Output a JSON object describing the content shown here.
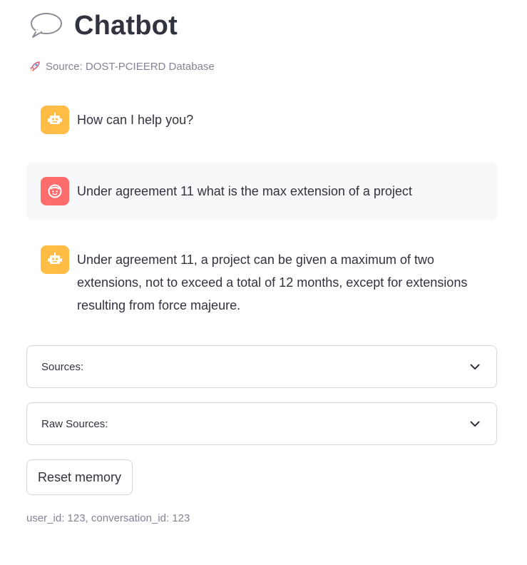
{
  "header": {
    "title_icon": "speech-balloon-icon",
    "title": "Chatbot",
    "caption_icon": "rocket-icon",
    "caption": "Source: DOST-PCIEERD Database"
  },
  "messages": [
    {
      "role": "assistant",
      "avatar_icon": "robot-icon",
      "text": "How can I help you?"
    },
    {
      "role": "user",
      "avatar_icon": "smiley-face-icon",
      "text": "Under agreement 11 what is the max extension of a project"
    },
    {
      "role": "assistant",
      "avatar_icon": "robot-icon",
      "text": "Under agreement 11, a project can be given a maximum of two extensions, not to exceed a total of 12 months, except for extensions resulting from force majeure."
    }
  ],
  "expanders": [
    {
      "label": "Sources:",
      "icon": "chevron-down-icon"
    },
    {
      "label": "Raw Sources:",
      "icon": "chevron-down-icon"
    }
  ],
  "reset_button": {
    "label": "Reset memory"
  },
  "footer": {
    "ids": "user_id: 123, conversation_id: 123"
  },
  "colors": {
    "bot_avatar": "#ffbd45",
    "user_avatar": "#ff6c6c",
    "text": "#31333f",
    "muted": "#808495",
    "user_bubble": "#f7f8fa",
    "border": "#d6d6d9"
  }
}
